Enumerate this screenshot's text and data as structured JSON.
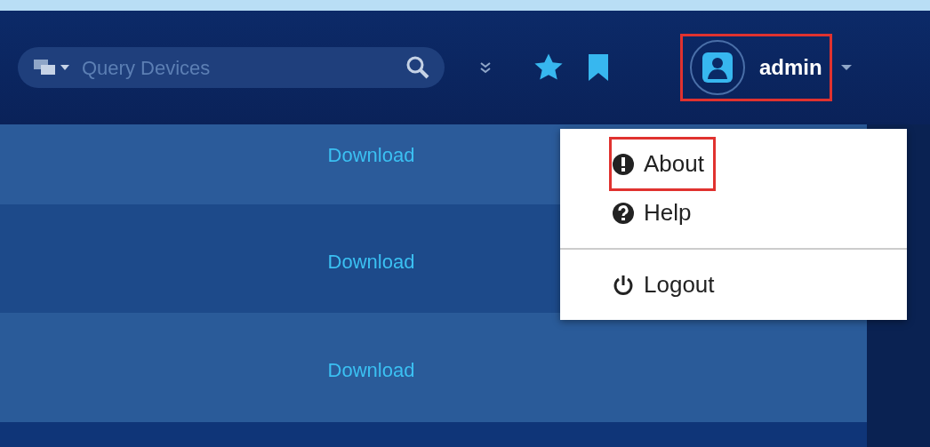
{
  "search": {
    "placeholder": "Query Devices"
  },
  "user": {
    "name": "admin",
    "highlighted": true
  },
  "rows": [
    {
      "link": "Download"
    },
    {
      "link": "Download"
    },
    {
      "link": "Download"
    }
  ],
  "user_menu": {
    "items": [
      {
        "kind": "item",
        "label": "About",
        "highlighted": true
      },
      {
        "kind": "item",
        "label": "Help",
        "highlighted": false
      },
      {
        "kind": "divider"
      },
      {
        "kind": "item",
        "label": "Logout",
        "highlighted": false
      }
    ]
  }
}
